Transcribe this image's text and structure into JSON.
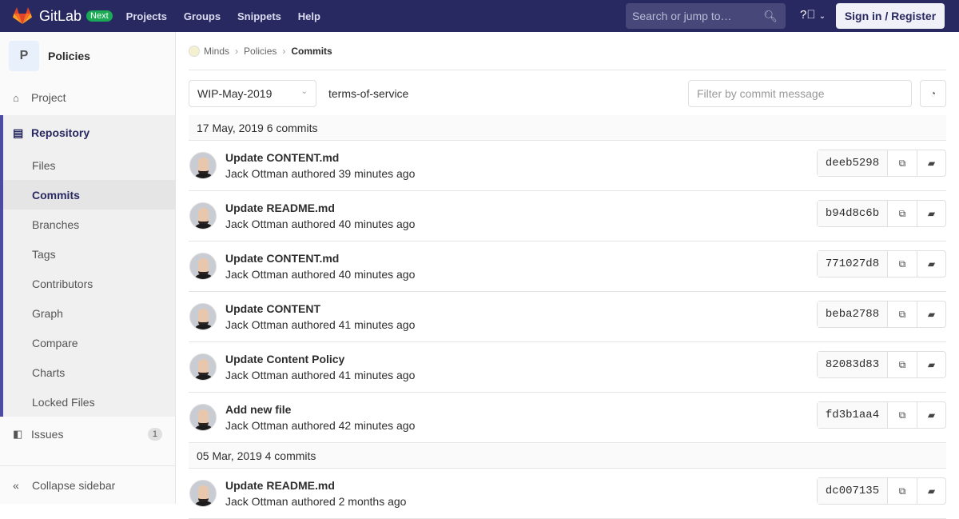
{
  "topbar": {
    "brand": "GitLab",
    "badge": "Next",
    "nav": [
      "Projects",
      "Groups",
      "Snippets",
      "Help"
    ],
    "search_placeholder": "Search or jump to…",
    "signin": "Sign in / Register"
  },
  "sidebar": {
    "project_initial": "P",
    "project_name": "Policies",
    "project": "Project",
    "repository": "Repository",
    "repo_items": [
      "Files",
      "Commits",
      "Branches",
      "Tags",
      "Contributors",
      "Graph",
      "Compare",
      "Charts",
      "Locked Files"
    ],
    "issues": "Issues",
    "issues_count": "1",
    "collapse": "Collapse sidebar"
  },
  "breadcrumb": [
    "Minds",
    "Policies",
    "Commits"
  ],
  "controls": {
    "branch": "WIP-May-2019",
    "path": "terms-of-service",
    "filter_placeholder": "Filter by commit message"
  },
  "groups": [
    {
      "date": "17 May, 2019",
      "count": "6 commits",
      "commits": [
        {
          "title": "Update CONTENT.md",
          "author": "Jack Ottman authored 39 minutes ago",
          "sha": "deeb5298"
        },
        {
          "title": "Update README.md",
          "author": "Jack Ottman authored 40 minutes ago",
          "sha": "b94d8c6b"
        },
        {
          "title": "Update CONTENT.md",
          "author": "Jack Ottman authored 40 minutes ago",
          "sha": "771027d8"
        },
        {
          "title": "Update CONTENT",
          "author": "Jack Ottman authored 41 minutes ago",
          "sha": "beba2788"
        },
        {
          "title": "Update Content Policy",
          "author": "Jack Ottman authored 41 minutes ago",
          "sha": "82083d83"
        },
        {
          "title": "Add new file",
          "author": "Jack Ottman authored 42 minutes ago",
          "sha": "fd3b1aa4"
        }
      ]
    },
    {
      "date": "05 Mar, 2019",
      "count": "4 commits",
      "commits": [
        {
          "title": "Update README.md",
          "author": "Jack Ottman authored 2 months ago",
          "sha": "dc007135"
        }
      ]
    }
  ]
}
